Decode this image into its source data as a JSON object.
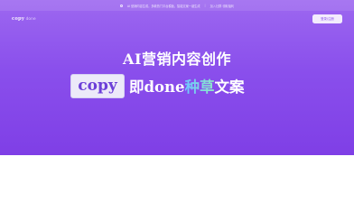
{
  "notice": {
    "text": "AI 营销内容生成，多款热门平台模板，智能文案一键生成",
    "separator": "|",
    "link": "加入社群 领取福利"
  },
  "nav": {
    "logo": "copy",
    "logo_sub": "done",
    "login_label": "登录/注册"
  },
  "hero": {
    "headline": "AI营销内容创作",
    "chip": "copy",
    "tag_prefix": "即done",
    "tag_highlight": "种草",
    "tag_suffix": "文案"
  },
  "colors": {
    "hero_top": "#9d68f0",
    "hero_bottom": "#7f3fe6",
    "chip_bg": "#ece9f9",
    "chip_text": "#6c3fd8",
    "highlight_start": "#6ec6ff",
    "highlight_end": "#8fe8c5"
  }
}
